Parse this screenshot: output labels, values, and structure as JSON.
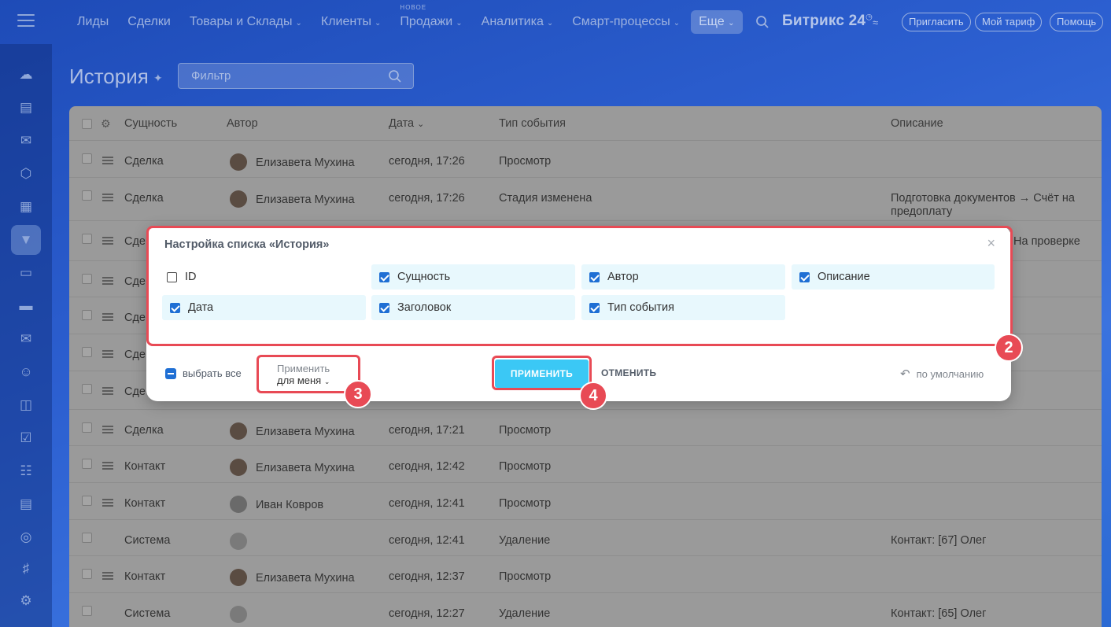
{
  "topnav": {
    "items": [
      {
        "label": "Лиды",
        "dropdown": false,
        "badge": ""
      },
      {
        "label": "Сделки",
        "dropdown": false,
        "badge": ""
      },
      {
        "label": "Товары и Склады",
        "dropdown": true,
        "badge": ""
      },
      {
        "label": "Клиенты",
        "dropdown": true,
        "badge": ""
      },
      {
        "label": "Продажи",
        "dropdown": true,
        "badge": "НОВОЕ"
      },
      {
        "label": "Аналитика",
        "dropdown": true,
        "badge": ""
      },
      {
        "label": "Смарт-процессы",
        "dropdown": true,
        "badge": ""
      }
    ],
    "more_label": "Еще",
    "brand": "Битрикс 24",
    "invite_label": "Пригласить",
    "tariff_label": "Мой тариф",
    "help_label": "Помощь"
  },
  "sidebar": {
    "icons": [
      "cloud-icon",
      "feed-icon",
      "chat-icon",
      "hexagon-icon",
      "calendar-icon",
      "crm-funnel-icon",
      "document-icon",
      "card-icon",
      "mail-icon",
      "users-icon",
      "presentation-icon",
      "tasks-icon",
      "planner-icon",
      "store-icon",
      "target-icon",
      "cart-icon",
      "settings-icon"
    ],
    "active_index": 5
  },
  "page": {
    "title": "История",
    "filter_placeholder": "Фильтр"
  },
  "table": {
    "columns": {
      "entity": "Сущность",
      "author": "Автор",
      "date": "Дата",
      "event_type": "Тип события",
      "description": "Описание"
    },
    "rows": [
      {
        "entity": "Сделка",
        "author": "Елизавета Мухина",
        "date": "сегодня, 17:26",
        "event": "Просмотр",
        "desc": "",
        "avatar": "elizaveta",
        "drag": true
      },
      {
        "entity": "Сделка",
        "author": "Елизавета Мухина",
        "date": "сегодня, 17:26",
        "event": "Стадия изменена",
        "desc": "Подготовка документов → Счёт на предоплату",
        "avatar": "elizaveta",
        "drag": true
      },
      {
        "entity": "Сде",
        "author": "",
        "date": "",
        "event": "",
        "desc": "На проверке",
        "avatar": "",
        "drag": true
      },
      {
        "entity": "Сде",
        "author": "",
        "date": "",
        "event": "",
        "desc": "",
        "avatar": "",
        "drag": true
      },
      {
        "entity": "Сде",
        "author": "",
        "date": "",
        "event": "",
        "desc": "",
        "avatar": "",
        "drag": true
      },
      {
        "entity": "Сде",
        "author": "",
        "date": "",
        "event": "",
        "desc": "",
        "avatar": "",
        "drag": true
      },
      {
        "entity": "Сде",
        "author": "",
        "date": "",
        "event": "",
        "desc": "",
        "avatar": "",
        "drag": true
      },
      {
        "entity": "Сделка",
        "author": "Елизавета Мухина",
        "date": "сегодня, 17:21",
        "event": "Просмотр",
        "desc": "",
        "avatar": "elizaveta",
        "drag": true
      },
      {
        "entity": "Контакт",
        "author": "Елизавета Мухина",
        "date": "сегодня, 12:42",
        "event": "Просмотр",
        "desc": "",
        "avatar": "elizaveta",
        "drag": true
      },
      {
        "entity": "Контакт",
        "author": "Иван Ковров",
        "date": "сегодня, 12:41",
        "event": "Просмотр",
        "desc": "",
        "avatar": "ivan",
        "drag": true
      },
      {
        "entity": "Система",
        "author": "",
        "date": "сегодня, 12:41",
        "event": "Удаление",
        "desc": "Контакт: [67] Олег",
        "avatar": "system",
        "drag": false
      },
      {
        "entity": "Контакт",
        "author": "Елизавета Мухина",
        "date": "сегодня, 12:37",
        "event": "Просмотр",
        "desc": "",
        "avatar": "elizaveta",
        "drag": true
      },
      {
        "entity": "Система",
        "author": "",
        "date": "сегодня, 12:27",
        "event": "Удаление",
        "desc": "Контакт: [65] Олег",
        "avatar": "system",
        "drag": false
      }
    ]
  },
  "dialog": {
    "title": "Настройка списка «История»",
    "fields": [
      {
        "label": "ID",
        "checked": false
      },
      {
        "label": "Сущность",
        "checked": true
      },
      {
        "label": "Автор",
        "checked": true
      },
      {
        "label": "Описание",
        "checked": true
      },
      {
        "label": "Дата",
        "checked": true
      },
      {
        "label": "Заголовок",
        "checked": true
      },
      {
        "label": "Тип события",
        "checked": true
      }
    ],
    "select_all_label": "выбрать все",
    "apply_for_label": "Применить",
    "apply_for_value": "для меня",
    "apply_button": "ПРИМЕНИТЬ",
    "cancel_button": "ОТМЕНИТЬ",
    "default_link": "по умолчанию"
  },
  "annotations": {
    "step2": "2",
    "step3": "3",
    "step4": "4",
    "color": "#e84a55"
  },
  "colors": {
    "accent_blue": "#3bc8f5",
    "checkbox_blue": "#1f6fd4",
    "field_highlight": "#e8f8fd"
  }
}
